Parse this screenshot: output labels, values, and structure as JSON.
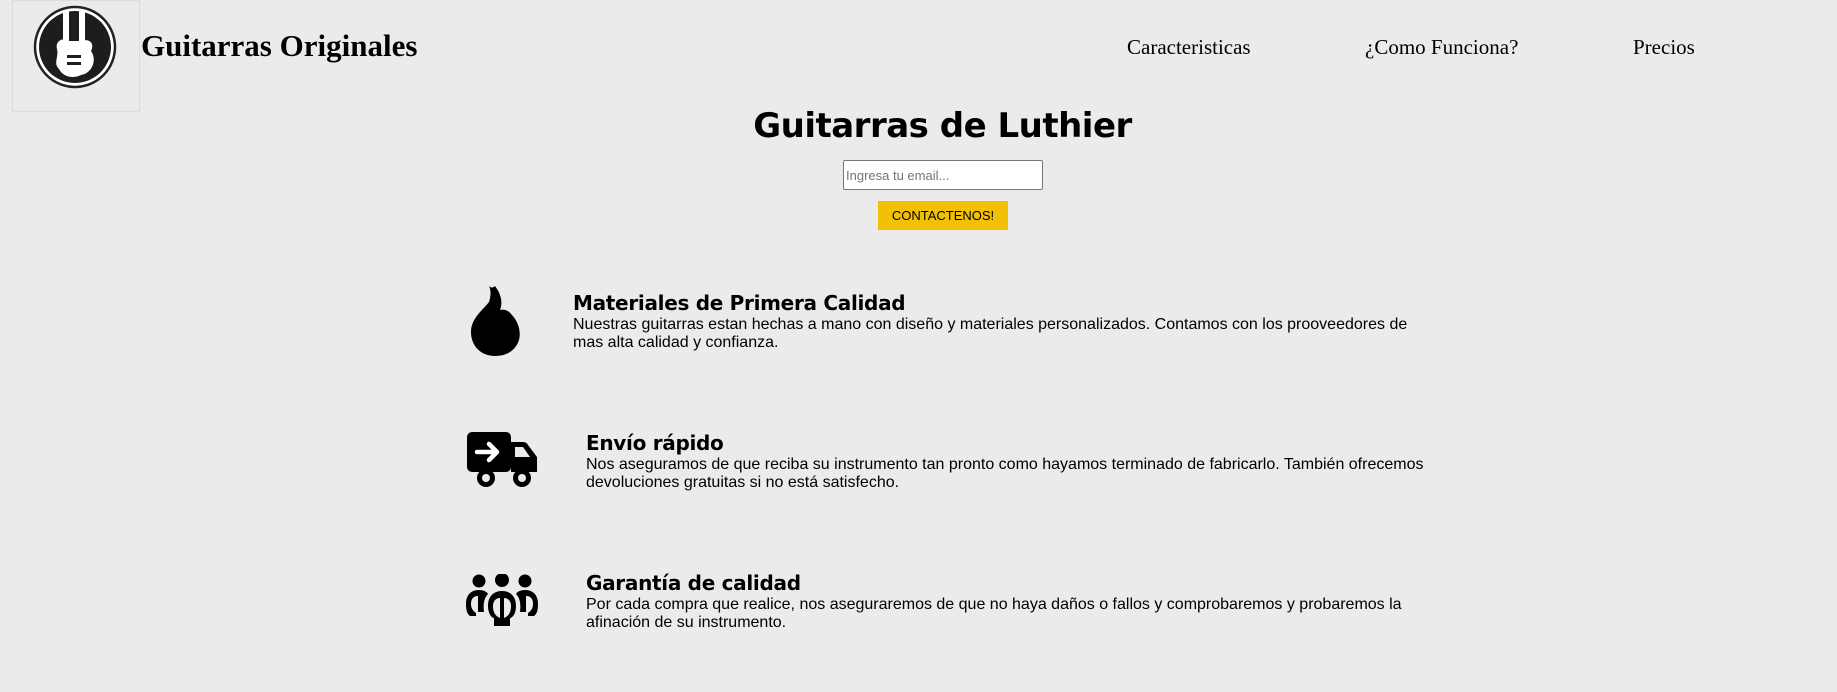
{
  "header": {
    "brand": "Guitarras Originales",
    "logo": "guitar-logo-icon",
    "nav": [
      {
        "label": "Caracteristicas"
      },
      {
        "label": "¿Como Funciona?"
      },
      {
        "label": "Precios"
      }
    ]
  },
  "hero": {
    "title": "Guitarras de Luthier",
    "email_placeholder": "Ingresa tu email...",
    "email_value": "",
    "button_label": "CONTACTENOS!"
  },
  "features": [
    {
      "icon": "fire-icon",
      "title": "Materiales de Primera Calidad",
      "text": "Nuestras guitarras estan hechas a mano con diseño y materiales personalizados. Contamos con los prooveedores de mas alta calidad y confianza."
    },
    {
      "icon": "shipping-truck-icon",
      "title": "Envío rápido",
      "text": "Nos aseguramos de que reciba su instrumento tan pronto como hayamos terminado de fabricarlo. También ofrecemos devoluciones gratuitas si no está satisfecho."
    },
    {
      "icon": "users-icon",
      "title": "Garantía de calidad",
      "text": "Por cada compra que realice, nos aseguraremos de que no haya daños o fallos y comprobaremos y probaremos la afinación de su instrumento."
    }
  ],
  "colors": {
    "background": "#ebebeb",
    "button": "#f2c005",
    "text": "#000000"
  }
}
